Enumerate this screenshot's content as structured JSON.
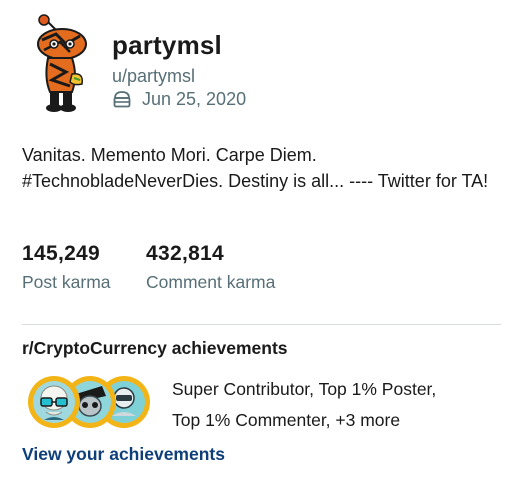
{
  "profile": {
    "display_name": "partymsl",
    "handle": "u/partymsl",
    "cake_day": "Jun 25, 2020",
    "bio": "Vanitas. Memento Mori. Carpe Diem. #TechnobladeNeverDies. Destiny is all... ---- Twitter for TA!"
  },
  "karma": {
    "post_value": "145,249",
    "post_label": "Post karma",
    "comment_value": "432,814",
    "comment_label": "Comment karma"
  },
  "achievements": {
    "title": "r/CryptoCurrency achievements",
    "line1": "Super Contributor, Top 1% Poster,",
    "line2": "Top 1% Commenter, +3 more",
    "link": "View your achievements",
    "badge_icons": [
      "skull-glasses-badge-icon",
      "robot-badge-icon",
      "astronaut-badge-icon"
    ]
  },
  "colors": {
    "badge_ring": "#f2b417",
    "link": "#0f3f7a",
    "muted": "#576f76",
    "divider": "#d9dcde"
  }
}
